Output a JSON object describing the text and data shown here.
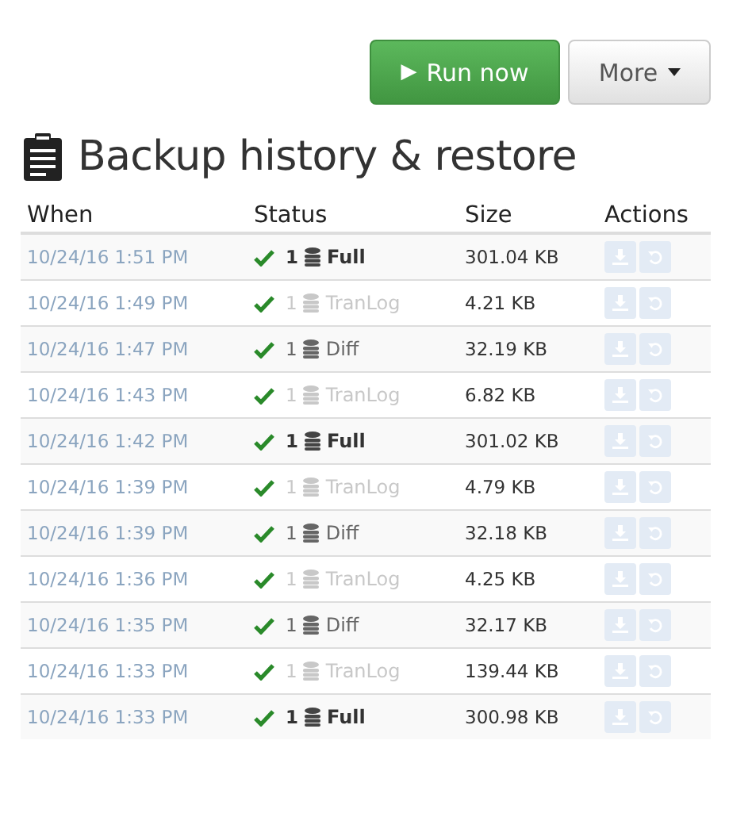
{
  "toolbar": {
    "run_button": {
      "icon": "▶",
      "label": "Run now"
    },
    "more_button": {
      "label": "More"
    }
  },
  "title": "Backup history & restore",
  "table": {
    "columns": [
      "When",
      "Status",
      "Size",
      "Actions"
    ],
    "rows": [
      {
        "when": "10/24/16 1:51 PM",
        "count": "1",
        "kind": "full",
        "type": "Full",
        "size": "301.04 KB",
        "actions_disabled": true
      },
      {
        "when": "10/24/16 1:49 PM",
        "count": "1",
        "kind": "tranlog",
        "type": "TranLog",
        "size": "4.21 KB",
        "actions_disabled": true
      },
      {
        "when": "10/24/16 1:47 PM",
        "count": "1",
        "kind": "diff",
        "type": "Diff",
        "size": "32.19 KB",
        "actions_disabled": true
      },
      {
        "when": "10/24/16 1:43 PM",
        "count": "1",
        "kind": "tranlog",
        "type": "TranLog",
        "size": "6.82 KB",
        "actions_disabled": true
      },
      {
        "when": "10/24/16 1:42 PM",
        "count": "1",
        "kind": "full",
        "type": "Full",
        "size": "301.02 KB",
        "actions_disabled": true
      },
      {
        "when": "10/24/16 1:39 PM",
        "count": "1",
        "kind": "tranlog",
        "type": "TranLog",
        "size": "4.79 KB",
        "actions_disabled": true
      },
      {
        "when": "10/24/16 1:39 PM",
        "count": "1",
        "kind": "diff",
        "type": "Diff",
        "size": "32.18 KB",
        "actions_disabled": true
      },
      {
        "when": "10/24/16 1:36 PM",
        "count": "1",
        "kind": "tranlog",
        "type": "TranLog",
        "size": "4.25 KB",
        "actions_disabled": true
      },
      {
        "when": "10/24/16 1:35 PM",
        "count": "1",
        "kind": "diff",
        "type": "Diff",
        "size": "32.17 KB",
        "actions_disabled": true
      },
      {
        "when": "10/24/16 1:33 PM",
        "count": "1",
        "kind": "tranlog",
        "type": "TranLog",
        "size": "139.44 KB",
        "actions_disabled": true
      },
      {
        "when": "10/24/16 1:33 PM",
        "count": "1",
        "kind": "full",
        "type": "Full",
        "size": "300.98 KB",
        "actions_disabled": true
      }
    ]
  }
}
